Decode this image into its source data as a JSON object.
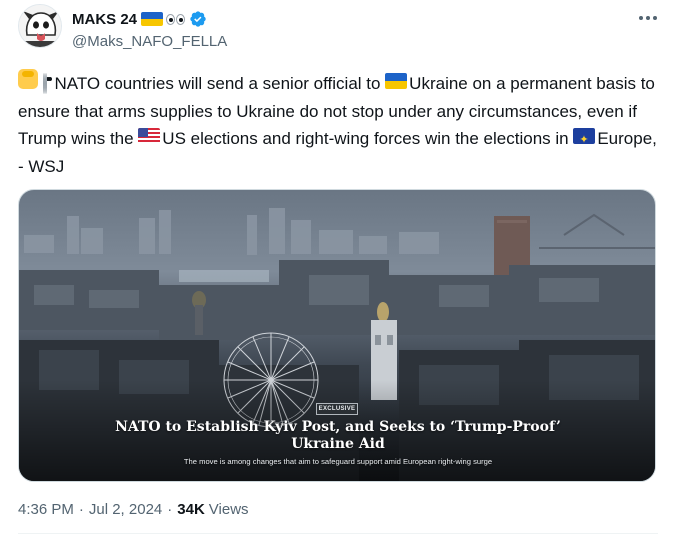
{
  "author": {
    "display_name": "MAKS 24",
    "handle": "@Maks_NAFO_FELLA",
    "verified": true,
    "name_emojis": [
      "flag-ukraine-icon",
      "eyes-icon"
    ]
  },
  "tweet": {
    "segments": {
      "s1": "NATO countries will send a senior official to ",
      "s2": "Ukraine on a permanent basis to ensure that arms supplies to Ukraine do not stop under any circumstances, even if Trump wins the ",
      "s3": "US elections and right-wing forces win the elections in ",
      "s4": "Europe, - WSJ"
    },
    "emojis": [
      "raised-fist-icon",
      "eyes-icon",
      "flag-ukraine-icon",
      "flag-us-icon",
      "flag-eu-icon"
    ]
  },
  "media": {
    "badge": "EXCLUSIVE",
    "headline_line1": "NATO to Establish Kyiv Post, and Seeks to ‘Trump-Proof’",
    "headline_line2": "Ukraine Aid",
    "dek": "The move is among changes that aim to safeguard support amid European right-wing surge"
  },
  "footer": {
    "time": "4:36 PM",
    "date": "Jul 2, 2024",
    "views_count": "34K",
    "views_label": "Views",
    "separator": "·"
  },
  "colors": {
    "text_primary": "#0f1419",
    "text_secondary": "#536471",
    "verified_blue": "#1d9bf0",
    "border": "#cfd9de"
  }
}
